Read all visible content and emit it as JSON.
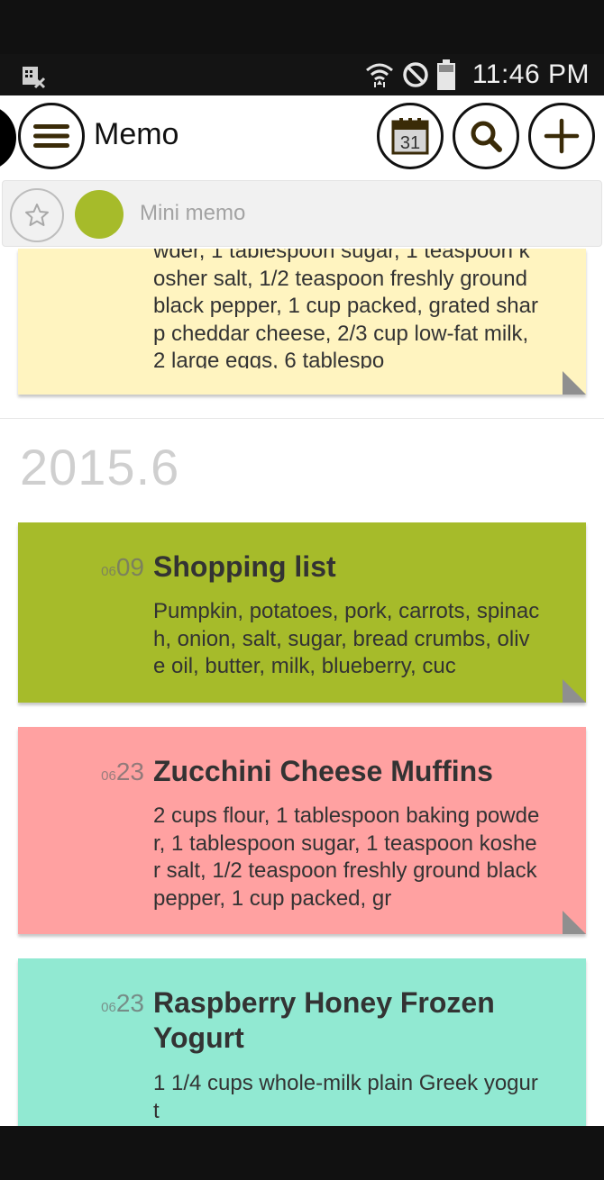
{
  "status_bar": {
    "time": "11:46 PM",
    "icons": [
      "blocked-calendar-icon",
      "wifi-icon",
      "do-not-disturb-icon",
      "battery-icon"
    ]
  },
  "app_bar": {
    "title": "Memo",
    "calendar_day": "31",
    "icons": [
      "menu-icon",
      "calendar-icon",
      "search-icon",
      "add-icon"
    ]
  },
  "mini_memo": {
    "placeholder": "Mini memo",
    "selected_color": "#a6bb2a"
  },
  "partial_card": {
    "color": "#fff4c0",
    "body": "wder, 1 tablespoon sugar, 1 teaspoon kosher salt, 1/2 teaspoon freshly ground black pepper, 1 cup packed, grated sharp cheddar cheese, 2/3 cup low-fat milk, 2 large eggs, 6 tablespo"
  },
  "month_header": "2015.6",
  "memos": [
    {
      "month": "06",
      "day": "09",
      "title": "Shopping list",
      "body": "Pumpkin, potatoes, pork, carrots, spinach, onion, salt, sugar, bread crumbs, olive oil, butter, milk, blueberry, cuc",
      "color": "#a6bb2a"
    },
    {
      "month": "06",
      "day": "23",
      "title": "Zucchini Cheese Muffins",
      "body": "2 cups flour, 1 tablespoon baking powder, 1 tablespoon sugar, 1 teaspoon kosher salt, 1/2 teaspoon freshly ground black pepper, 1 cup packed, gr",
      "color": "#ffa1a1"
    },
    {
      "month": "06",
      "day": "23",
      "title": "Raspberry Honey Frozen Yogurt",
      "body": "1 1/4 cups whole-milk plain Greek yogurt",
      "color": "#91e9d2"
    }
  ]
}
